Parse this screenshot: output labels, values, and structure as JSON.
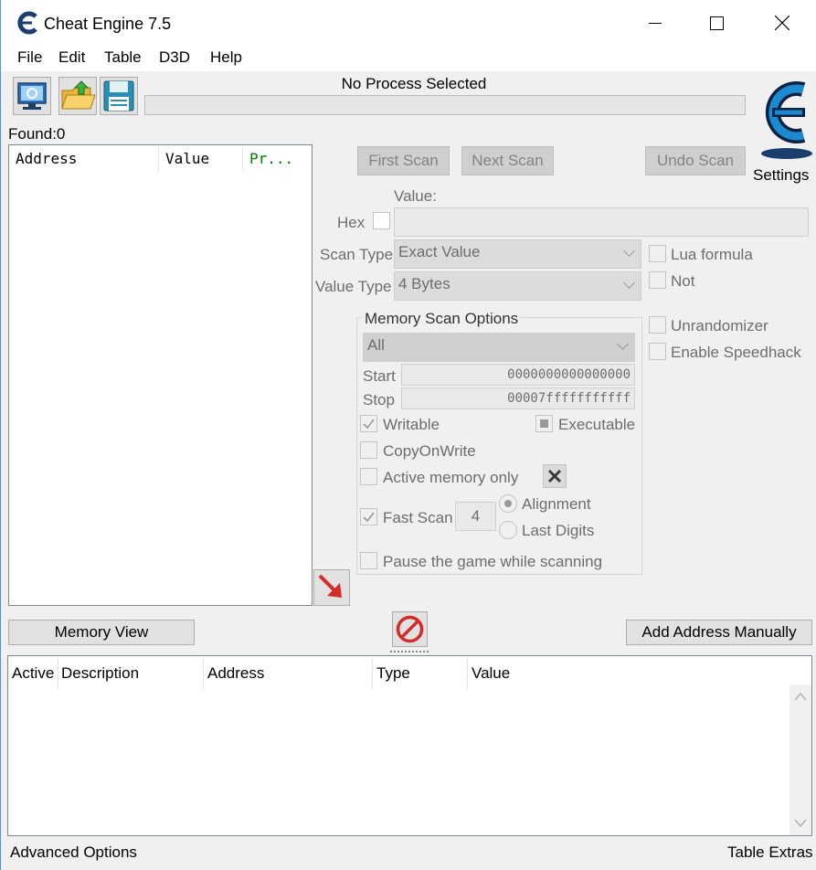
{
  "window": {
    "title": "Cheat Engine 7.5"
  },
  "menu": [
    "File",
    "Edit",
    "Table",
    "D3D",
    "Help"
  ],
  "process": {
    "label": "No Process Selected"
  },
  "settings_label": "Settings",
  "found": {
    "label": "Found:0"
  },
  "results_columns": {
    "address": "Address",
    "value": "Value",
    "previous": "Pr..."
  },
  "scan_buttons": {
    "first": "First Scan",
    "next": "Next Scan",
    "undo": "Undo Scan"
  },
  "value_section": {
    "value_label": "Value:",
    "hex_label": "Hex",
    "value": ""
  },
  "scan_type": {
    "label": "Scan Type",
    "selected": "Exact Value"
  },
  "value_type": {
    "label": "Value Type",
    "selected": "4 Bytes"
  },
  "right_options": {
    "lua_formula": "Lua formula",
    "not": "Not",
    "unrandomizer": "Unrandomizer",
    "speedhack": "Enable Speedhack"
  },
  "memory_scan_options": {
    "title": "Memory Scan Options",
    "region": "All",
    "start_label": "Start",
    "start_value": "0000000000000000",
    "stop_label": "Stop",
    "stop_value": "00007fffffffffff",
    "writable": "Writable",
    "executable": "Executable",
    "copy_on_write": "CopyOnWrite",
    "active_memory_only": "Active memory only",
    "fast_scan": "Fast Scan",
    "fast_scan_value": "4",
    "alignment": "Alignment",
    "last_digits": "Last Digits",
    "pause_game": "Pause the game while scanning"
  },
  "memory_view_button": "Memory View",
  "add_address_button": "Add Address Manually",
  "address_list_columns": {
    "active": "Active",
    "description": "Description",
    "address": "Address",
    "type": "Type",
    "value": "Value"
  },
  "bottom": {
    "advanced": "Advanced Options",
    "extras": "Table Extras"
  },
  "colors": {
    "previous_column": "#008000",
    "arrow_red": "#d62b2b",
    "logo_blue": "#1b6fb5"
  }
}
